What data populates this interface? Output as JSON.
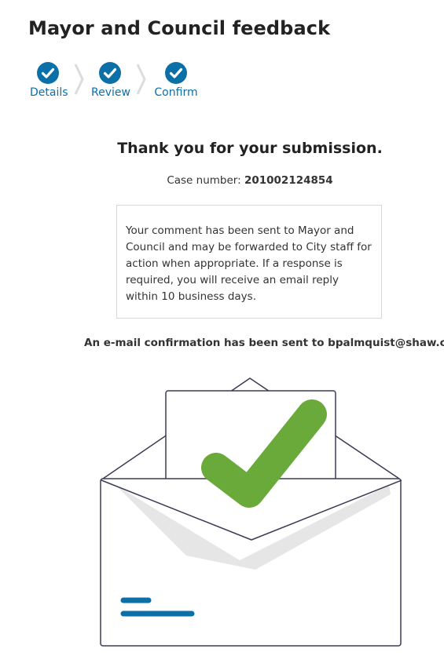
{
  "page": {
    "title": "Mayor and Council feedback"
  },
  "steps": [
    {
      "label": "Details",
      "state": "complete"
    },
    {
      "label": "Review",
      "state": "complete"
    },
    {
      "label": "Confirm",
      "state": "complete"
    }
  ],
  "confirmation": {
    "heading": "Thank you for your submission.",
    "case_label": "Case number:",
    "case_number": "201002124854",
    "message": "Your comment has been sent to Mayor and Council and may be forwarded to City staff for action when appropriate. If a response is required, you will receive an email reply within 10 business days.",
    "email_notice": "An e-mail confirmation has been sent to bpalmquist@shaw.ca"
  },
  "colors": {
    "accent": "#0b6fa8",
    "check_green": "#6aaa3a",
    "envelope_outline": "#3b3b55",
    "envelope_shadow": "#e6e6e6"
  }
}
